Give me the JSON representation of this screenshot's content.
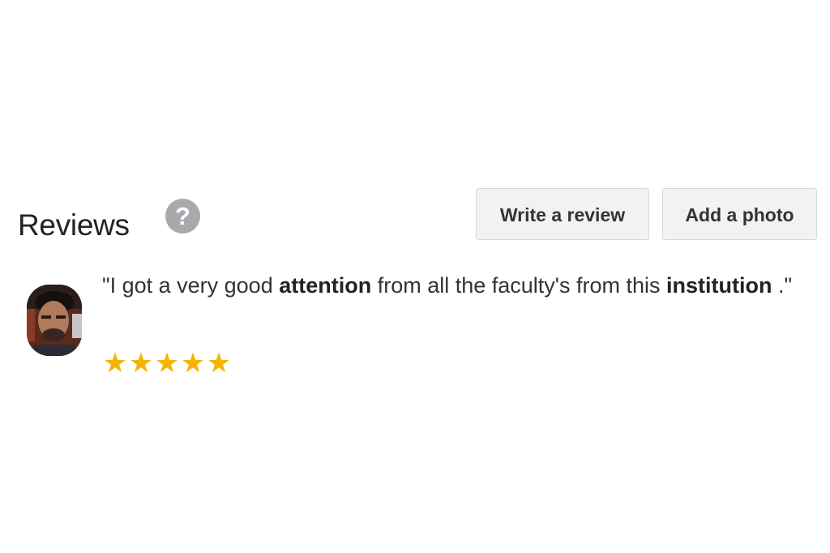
{
  "reviews": {
    "title": "Reviews",
    "help_icon": "question-mark-circle-icon",
    "help_glyph": "?",
    "write_review_label": "Write a review",
    "add_photo_label": "Add a photo"
  },
  "review": {
    "text_parts": [
      {
        "text": "\"I got a very good ",
        "bold": false
      },
      {
        "text": "attention",
        "bold": true
      },
      {
        "text": " from all the faculty's from this ",
        "bold": false
      },
      {
        "text": "institution",
        "bold": true
      },
      {
        "text": " .\"",
        "bold": false
      }
    ],
    "rating": 5,
    "max_rating": 5,
    "star_glyph": "★",
    "star_color": "#f4b400"
  },
  "colors": {
    "help_icon_bg": "#a9a9ad",
    "button_bg": "#f2f2f2"
  }
}
